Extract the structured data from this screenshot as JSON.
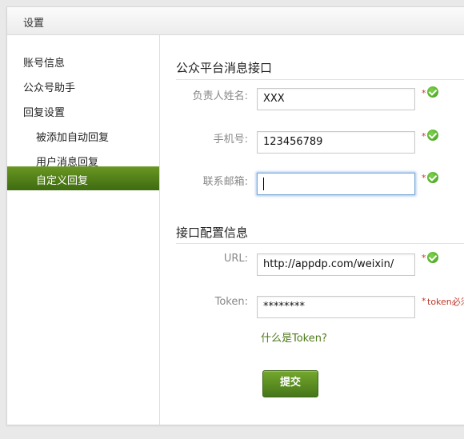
{
  "header": {
    "title": "设置"
  },
  "sidebar": {
    "items": [
      {
        "label": "账号信息"
      },
      {
        "label": "公众号助手"
      },
      {
        "label": "回复设置"
      },
      {
        "label": "被添加自动回复"
      },
      {
        "label": "用户消息回复"
      },
      {
        "label": "自定义回复",
        "active": true
      }
    ]
  },
  "form": {
    "section1_title": "公众平台消息接口",
    "fields1": [
      {
        "label": "负责人姓名:",
        "value": "XXX",
        "required": "*",
        "status": "check-icon"
      },
      {
        "label": "手机号:",
        "value": "123456789",
        "required": "*",
        "status": "check-icon"
      },
      {
        "label": "联系邮箱:",
        "value": "",
        "required": "*",
        "status": "check-icon",
        "focused": true
      }
    ],
    "section2_title": "接口配置信息",
    "url": {
      "label": "URL:",
      "value": "http://appdp.com/weixin/",
      "required": "*",
      "status": "check-icon"
    },
    "token": {
      "label": "Token:",
      "value": "********",
      "required": "*",
      "error": "token必须"
    },
    "help_link": "什么是Token?",
    "submit_label": "提交"
  },
  "colors": {
    "accent": "#4f7a1a",
    "error": "#c0392b",
    "check": "#4caf20"
  }
}
